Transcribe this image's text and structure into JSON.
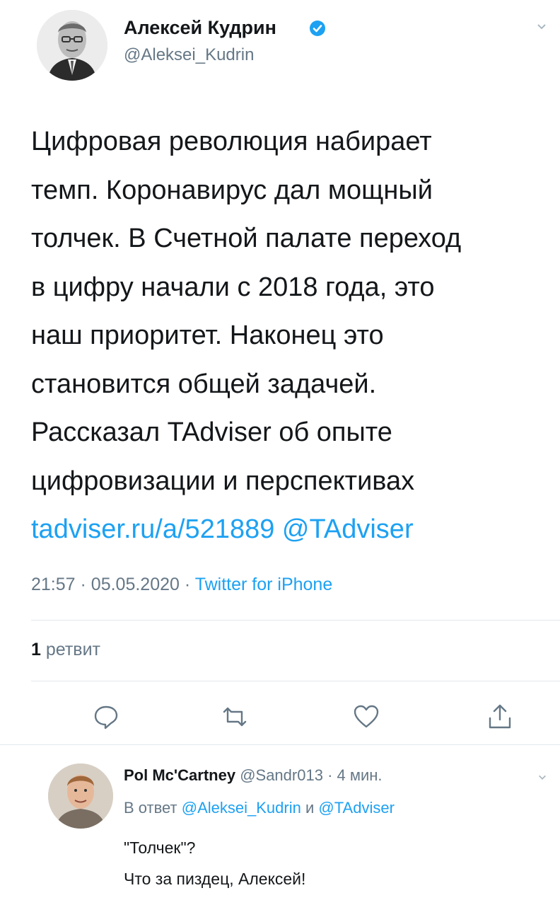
{
  "tweet": {
    "author_name": "Алексей Кудрин",
    "author_handle": "@Aleksei_Kudrin",
    "text_lines": [
      "Цифровая революция набирает",
      "темп. Коронавирус дал мощный",
      "толчек. В Счетной  палате переход",
      "в цифру начали с 2018 года, это",
      "наш  приоритет. Наконец это",
      "становится общей задачей.",
      "Рассказал TAdviser об опыте",
      "цифровизации и перспективах"
    ],
    "link": "tadviser.ru/a/521889",
    "mention": "@TAdviser",
    "time": "21:57",
    "date": "05.05.2020",
    "source": "Twitter for iPhone",
    "retweet_count": "1",
    "retweet_label": "ретвит",
    "icons": {
      "verified": "verified-badge-icon",
      "reply": "reply-icon",
      "retweet": "retweet-icon",
      "like": "heart-icon",
      "share": "share-icon"
    },
    "colors": {
      "link": "#1da1f2",
      "secondary": "#657786",
      "text": "#14171a"
    }
  },
  "reply": {
    "author_name": "Pol Mc'Cartney",
    "author_handle": "@Sandr013",
    "time_ago": "4 мин.",
    "reply_prefix": "В ответ",
    "reply_mention_1": "@Aleksei_Kudrin",
    "reply_and": "и",
    "reply_mention_2": "@TAdviser",
    "text_line_1": "\"Толчек\"?",
    "text_line_2": "Что за пиздец, Алексей!"
  }
}
